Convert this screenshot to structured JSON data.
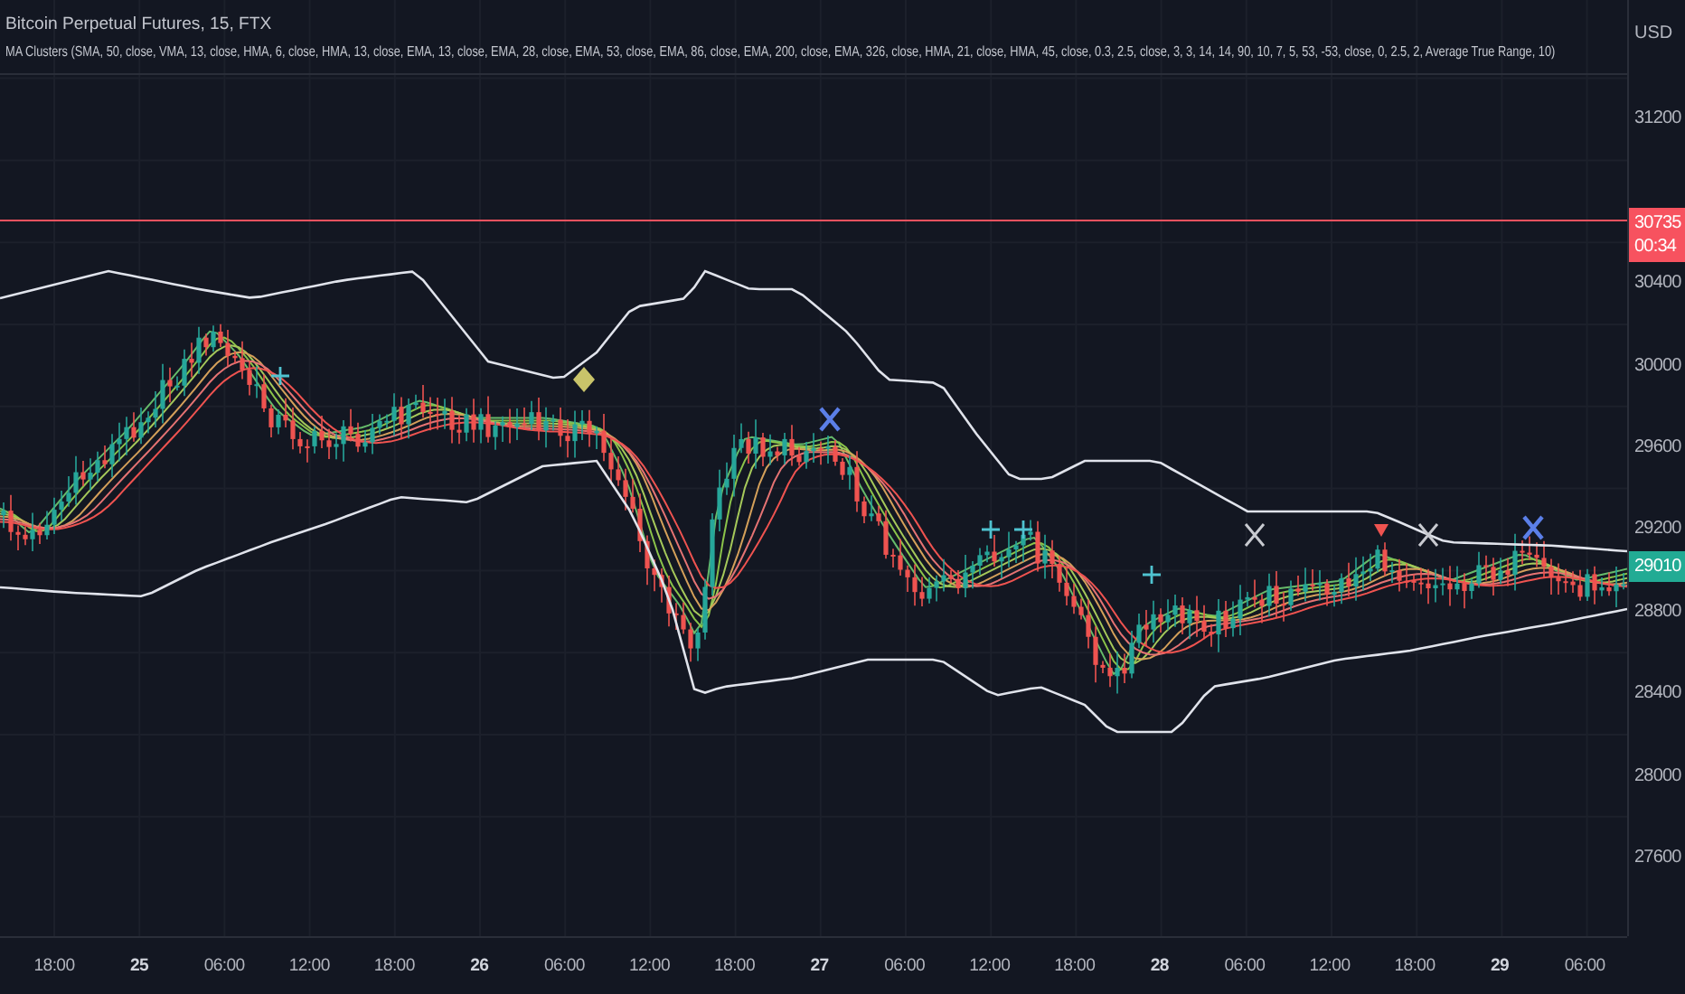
{
  "legend": {
    "symbol": "Bitcoin Perpetual Futures, 15, FTX",
    "indicator": "MA Clusters (SMA, 50, close, VMA, 13, close, HMA, 6, close, HMA, 13, close, EMA, 13, close, EMA, 28, close, EMA, 53, close, EMA, 86, close, EMA, 200, close, EMA, 326, close, HMA, 21, close, HMA, 45, close, 0.3, 2.5, close, 3, 3, 14, 14, 90, 10, 7, 5, 53, -53, close, 0, 2.5, 2, Average True Range, 10)"
  },
  "price_axis": {
    "currency": "USD",
    "labels": [
      "31200",
      "30400",
      "30000",
      "29600",
      "29200",
      "28800",
      "28400",
      "28000",
      "27600"
    ]
  },
  "badges": [
    {
      "kind": "last",
      "price": "30735",
      "countdown": "00:34",
      "color": "#f7525f"
    },
    {
      "kind": "indicator",
      "price": "29010",
      "color": "#22ab94"
    }
  ],
  "time_axis": {
    "labels": [
      {
        "text": "18:00",
        "bold": false
      },
      {
        "text": "25",
        "bold": true
      },
      {
        "text": "06:00",
        "bold": false
      },
      {
        "text": "12:00",
        "bold": false
      },
      {
        "text": "18:00",
        "bold": false
      },
      {
        "text": "26",
        "bold": true
      },
      {
        "text": "06:00",
        "bold": false
      },
      {
        "text": "12:00",
        "bold": false
      },
      {
        "text": "18:00",
        "bold": false
      },
      {
        "text": "27",
        "bold": true
      },
      {
        "text": "06:00",
        "bold": false
      },
      {
        "text": "12:00",
        "bold": false
      },
      {
        "text": "18:00",
        "bold": false
      },
      {
        "text": "28",
        "bold": true
      },
      {
        "text": "06:00",
        "bold": false
      },
      {
        "text": "12:00",
        "bold": false
      },
      {
        "text": "18:00",
        "bold": false
      },
      {
        "text": "29",
        "bold": true
      },
      {
        "text": "06:00",
        "bold": false
      }
    ]
  }
}
